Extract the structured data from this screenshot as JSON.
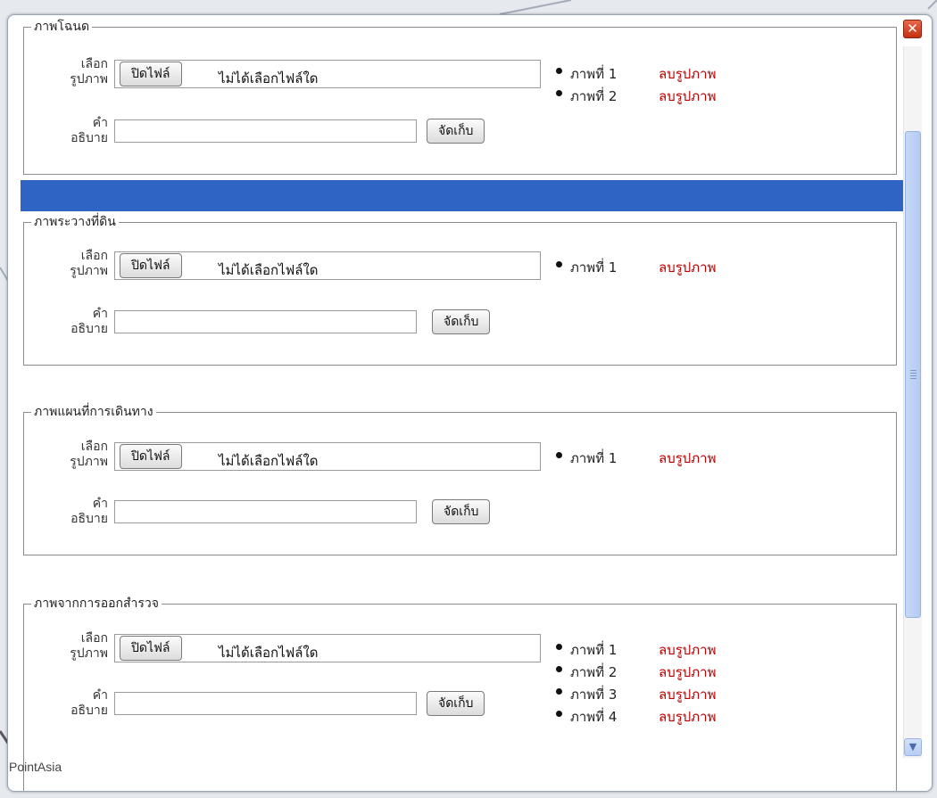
{
  "dialog": {
    "close_icon": "close-icon",
    "close_glyph": "✕"
  },
  "common": {
    "select_image_label_1": "เลือก",
    "select_image_label_2": "รูปภาพ",
    "description_label_1": "คำ",
    "description_label_2": "อธิบาย",
    "browse_button": "ปิดไฟล์",
    "no_file_text": "ไม่ได้เลือกไฟล์ใด",
    "save_button": "จัดเก็บ",
    "delete_link": "ลบรูปภาพ"
  },
  "sections": [
    {
      "title": "ภาพโฉนด",
      "images": [
        "ภาพที่ 1",
        "ภาพที่ 2"
      ]
    },
    {
      "title": "ภาพระวางที่ดิน",
      "images": [
        "ภาพที่ 1"
      ]
    },
    {
      "title": "ภาพแผนที่การเดินทาง",
      "images": [
        "ภาพที่ 1"
      ]
    },
    {
      "title": "ภาพจากการออกสำรวจ",
      "images": [
        "ภาพที่ 1",
        "ภาพที่ 2",
        "ภาพที่ 3",
        "ภาพที่ 4"
      ]
    }
  ],
  "scrollbar": {
    "scroll_down_icon": "chevron-down-icon",
    "arrow_glyph": "▼"
  },
  "footer": {
    "brand_text": "PointAsia"
  },
  "colors": {
    "accent_bar": "#2f63c4",
    "delete_link": "#c00000",
    "close_button": "#c52f12",
    "scroll_thumb": "#b5cbf1"
  }
}
